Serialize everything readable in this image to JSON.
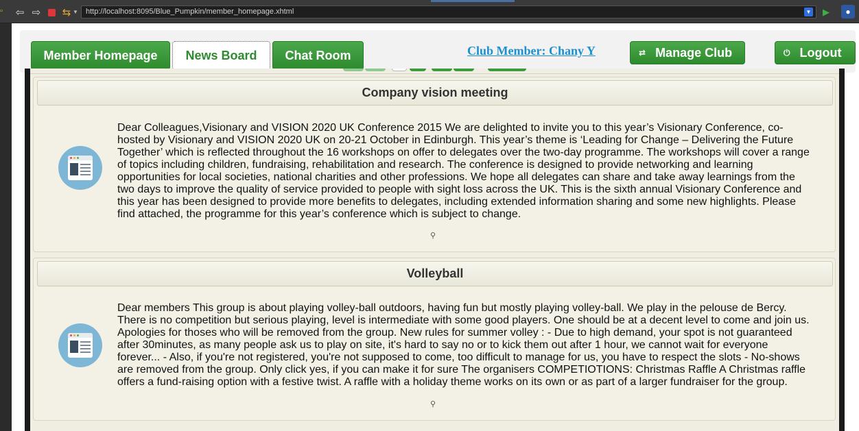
{
  "browser": {
    "url": "http://localhost:8095/Blue_Pumpkin/member_homepage.xhtml",
    "icons": {
      "back": "arrow-left-icon",
      "forward": "arrow-right-icon",
      "stop": "stop-icon",
      "sync": "sync-icon",
      "go": "play-icon",
      "extension": "extension-icon",
      "url_dropdown": "chevron-down-icon"
    }
  },
  "nav": {
    "tabs": [
      {
        "label": "Member Homepage"
      },
      {
        "label": "News Board"
      },
      {
        "label": "Chat Room"
      }
    ],
    "member_label": "Club Member: Chany Y",
    "manage_label": "Manage Club",
    "logout_label": "Logout",
    "manage_icon": "swap-arrows-icon",
    "logout_icon": "power-icon",
    "active_tab": "News Board"
  },
  "news": [
    {
      "title": "Company vision meeting",
      "body": "Dear Colleagues,Visionary and VISION 2020 UK Conference 2015 We are delighted to invite you to this year’s Visionary Conference, co-hosted by Visionary and VISION 2020 UK on 20-21 October in Edinburgh. This year’s theme is ‘Leading for Change – Delivering the Future Together’ which is reflected throughout the 16 workshops on offer to delegates over the two-day programme. The workshops will cover a range of topics including children, fundraising, rehabilitation and research. The conference is designed to provide networking and learning opportunities for local societies, national charities and other professions. We hope all delegates can share and take away learnings from the two days to improve the quality of service provided to people with sight loss across the UK. This is the sixth annual Visionary Conference and this year has been designed to provide more benefits to delegates, including extended information sharing and some new highlights. Please find attached, the programme for this year’s conference which is subject to change.",
      "icon": "news-document-icon"
    },
    {
      "title": "Volleyball",
      "body": "Dear members This group is about playing volley-ball outdoors, having fun but mostly playing volley-ball. We play in the pelouse de Bercy. There is no competition but serious playing, level is intermediate with some good players. One should be at a decent level to come and join us. Apologies for thoses who will be removed from the group. New rules for summer volley : - Due to high demand, your spot is not guaranteed after 30minutes, as many people ask us to play on site, it's hard to say no or to kick them out after 1 hour, we cannot wait for everyone forever... - Also, if you're not registered, you're not supposed to come, too difficult to manage for us, you have to respect the slots - No-shows are removed from the group. Only click yes, if you can make it for sure The organisers COMPETIOTIONS: Christmas Raffle A Christmas raffle offers a fund-raising option with a festive twist. A raffle with a holiday theme works on its own or as part of a larger fundraiser for the group.",
      "icon": "news-document-icon"
    }
  ],
  "colors": {
    "button_green": "#3d9a3d",
    "link_blue": "#1e8fcf",
    "board_bg": "#f0eee2"
  }
}
